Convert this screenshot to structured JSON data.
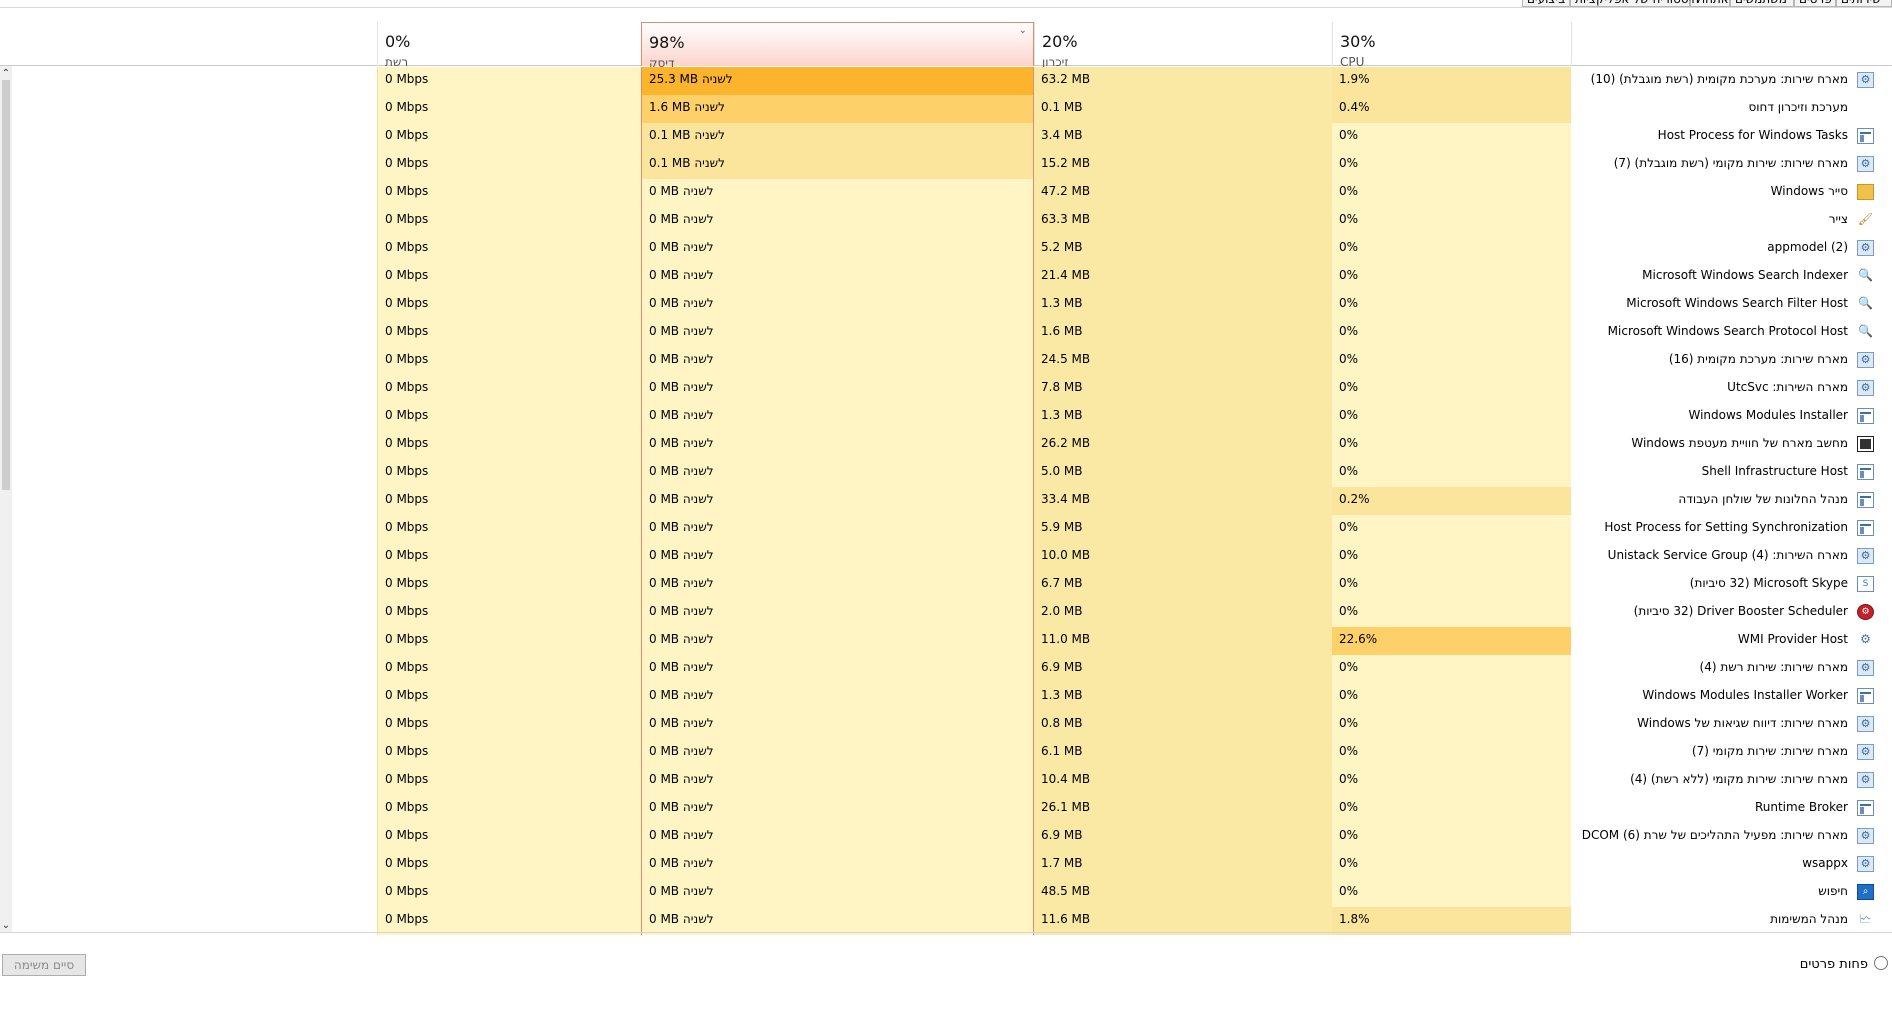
{
  "tabs": [
    "שירותים",
    "פרטים",
    "משתמשים",
    "אתחול",
    "היסטוריה של אפליקציות",
    "ביצועים"
  ],
  "header": {
    "network": {
      "percent": "0%",
      "label": "רשת"
    },
    "disk": {
      "percent": "98%",
      "label": "דיסק"
    },
    "memory": {
      "percent": "20%",
      "label": "זיכרון"
    },
    "cpu": {
      "percent": "30%",
      "label": "CPU"
    }
  },
  "icons": {
    "gear": "⚙",
    "paint": "🖌",
    "search": "🔍",
    "skype": "S",
    "driver": "⚙",
    "wmi": "⚙",
    "find": "⌕",
    "sched": "🗠"
  },
  "colors": {
    "cell_light": "#fff4c4",
    "cell_mem": "#f9e9a5",
    "heat_high": "#fcb42c",
    "heat_mid": "#fdd06a",
    "heat_low": "#fbe59c",
    "sorted_border": "#e08b72"
  },
  "processes": [
    {
      "name": "מארח שירות: מערכת מקומית (רשת מוגבלת) (10)",
      "icon": "gear",
      "cpu": "1.9%",
      "memory": "63.2 MB",
      "disk": "25.3 MB לשניה",
      "network": "0 Mbps",
      "disk_heat": "high",
      "cpu_heat": "low"
    },
    {
      "name": "מערכת וזיכרון דחוס",
      "icon": "none",
      "cpu": "0.4%",
      "memory": "0.1 MB",
      "disk": "1.6 MB לשניה",
      "network": "0 Mbps",
      "disk_heat": "mid",
      "cpu_heat": "low"
    },
    {
      "name": "Host Process for Windows Tasks",
      "icon": "win",
      "cpu": "0%",
      "memory": "3.4 MB",
      "disk": "0.1 MB לשניה",
      "network": "0 Mbps",
      "disk_heat": "low",
      "cpu_heat": ""
    },
    {
      "name": "מארח שירות: שירות מקומי (רשת מוגבלת) (7)",
      "icon": "gear",
      "cpu": "0%",
      "memory": "15.2 MB",
      "disk": "0.1 MB לשניה",
      "network": "0 Mbps",
      "disk_heat": "low",
      "cpu_heat": ""
    },
    {
      "name": "סייר Windows",
      "icon": "folder",
      "cpu": "0%",
      "memory": "47.2 MB",
      "disk": "0 MB לשניה",
      "network": "0 Mbps",
      "disk_heat": "",
      "cpu_heat": ""
    },
    {
      "name": "צייר",
      "icon": "paint",
      "cpu": "0%",
      "memory": "63.3 MB",
      "disk": "0 MB לשניה",
      "network": "0 Mbps",
      "disk_heat": "",
      "cpu_heat": ""
    },
    {
      "name": "appmodel (2)",
      "icon": "gear",
      "cpu": "0%",
      "memory": "5.2 MB",
      "disk": "0 MB לשניה",
      "network": "0 Mbps",
      "disk_heat": "",
      "cpu_heat": ""
    },
    {
      "name": "Microsoft Windows Search Indexer",
      "icon": "search",
      "cpu": "0%",
      "memory": "21.4 MB",
      "disk": "0 MB לשניה",
      "network": "0 Mbps",
      "disk_heat": "",
      "cpu_heat": ""
    },
    {
      "name": "Microsoft Windows Search Filter Host",
      "icon": "search",
      "cpu": "0%",
      "memory": "1.3 MB",
      "disk": "0 MB לשניה",
      "network": "0 Mbps",
      "disk_heat": "",
      "cpu_heat": ""
    },
    {
      "name": "Microsoft Windows Search Protocol Host",
      "icon": "search",
      "cpu": "0%",
      "memory": "1.6 MB",
      "disk": "0 MB לשניה",
      "network": "0 Mbps",
      "disk_heat": "",
      "cpu_heat": ""
    },
    {
      "name": "מארח שירות: מערכת מקומית (16)",
      "icon": "gear",
      "cpu": "0%",
      "memory": "24.5 MB",
      "disk": "0 MB לשניה",
      "network": "0 Mbps",
      "disk_heat": "",
      "cpu_heat": ""
    },
    {
      "name": "מארח השירות: UtcSvc",
      "icon": "gear",
      "cpu": "0%",
      "memory": "7.8 MB",
      "disk": "0 MB לשניה",
      "network": "0 Mbps",
      "disk_heat": "",
      "cpu_heat": ""
    },
    {
      "name": "Windows Modules Installer",
      "icon": "win",
      "cpu": "0%",
      "memory": "1.3 MB",
      "disk": "0 MB לשניה",
      "network": "0 Mbps",
      "disk_heat": "",
      "cpu_heat": ""
    },
    {
      "name": "מחשב מארח של חוויית מעטפת Windows",
      "icon": "dark",
      "cpu": "0%",
      "memory": "26.2 MB",
      "disk": "0 MB לשניה",
      "network": "0 Mbps",
      "disk_heat": "",
      "cpu_heat": ""
    },
    {
      "name": "Shell Infrastructure Host",
      "icon": "win",
      "cpu": "0%",
      "memory": "5.0 MB",
      "disk": "0 MB לשניה",
      "network": "0 Mbps",
      "disk_heat": "",
      "cpu_heat": ""
    },
    {
      "name": "מנהל החלונות של שולחן העבודה",
      "icon": "win",
      "cpu": "0.2%",
      "memory": "33.4 MB",
      "disk": "0 MB לשניה",
      "network": "0 Mbps",
      "disk_heat": "",
      "cpu_heat": "low"
    },
    {
      "name": "Host Process for Setting Synchronization",
      "icon": "win",
      "cpu": "0%",
      "memory": "5.9 MB",
      "disk": "0 MB לשניה",
      "network": "0 Mbps",
      "disk_heat": "",
      "cpu_heat": ""
    },
    {
      "name": "מארח השירות: Unistack Service Group (4)",
      "icon": "gear",
      "cpu": "0%",
      "memory": "10.0 MB",
      "disk": "0 MB לשניה",
      "network": "0 Mbps",
      "disk_heat": "",
      "cpu_heat": ""
    },
    {
      "name": "Microsoft Skype (32 סיביות)",
      "icon": "skype",
      "cpu": "0%",
      "memory": "6.7 MB",
      "disk": "0 MB לשניה",
      "network": "0 Mbps",
      "disk_heat": "",
      "cpu_heat": ""
    },
    {
      "name": "Driver Booster Scheduler (32 סיביות)",
      "icon": "red",
      "cpu": "0%",
      "memory": "2.0 MB",
      "disk": "0 MB לשניה",
      "network": "0 Mbps",
      "disk_heat": "",
      "cpu_heat": ""
    },
    {
      "name": "WMI Provider Host",
      "icon": "wmi",
      "cpu": "22.6%",
      "memory": "11.0 MB",
      "disk": "0 MB לשניה",
      "network": "0 Mbps",
      "disk_heat": "",
      "cpu_heat": "mid"
    },
    {
      "name": "מארח שירות: שירות רשת (4)",
      "icon": "gear",
      "cpu": "0%",
      "memory": "6.9 MB",
      "disk": "0 MB לשניה",
      "network": "0 Mbps",
      "disk_heat": "",
      "cpu_heat": ""
    },
    {
      "name": "Windows Modules Installer Worker",
      "icon": "win",
      "cpu": "0%",
      "memory": "1.3 MB",
      "disk": "0 MB לשניה",
      "network": "0 Mbps",
      "disk_heat": "",
      "cpu_heat": ""
    },
    {
      "name": "מארח שירות: דיווח שגיאות של Windows",
      "icon": "gear",
      "cpu": "0%",
      "memory": "0.8 MB",
      "disk": "0 MB לשניה",
      "network": "0 Mbps",
      "disk_heat": "",
      "cpu_heat": ""
    },
    {
      "name": "מארח שירות: שירות מקומי (7)",
      "icon": "gear",
      "cpu": "0%",
      "memory": "6.1 MB",
      "disk": "0 MB לשניה",
      "network": "0 Mbps",
      "disk_heat": "",
      "cpu_heat": ""
    },
    {
      "name": "מארח שירות: שירות מקומי (ללא רשת) (4)",
      "icon": "gear",
      "cpu": "0%",
      "memory": "10.4 MB",
      "disk": "0 MB לשניה",
      "network": "0 Mbps",
      "disk_heat": "",
      "cpu_heat": ""
    },
    {
      "name": "Runtime Broker",
      "icon": "win",
      "cpu": "0%",
      "memory": "26.1 MB",
      "disk": "0 MB לשניה",
      "network": "0 Mbps",
      "disk_heat": "",
      "cpu_heat": ""
    },
    {
      "name": "מארח שירות: מפעיל התהליכים של שרת DCOM (6)",
      "icon": "gear",
      "cpu": "0%",
      "memory": "6.9 MB",
      "disk": "0 MB לשניה",
      "network": "0 Mbps",
      "disk_heat": "",
      "cpu_heat": ""
    },
    {
      "name": "wsappx",
      "icon": "gear",
      "cpu": "0%",
      "memory": "1.7 MB",
      "disk": "0 MB לשניה",
      "network": "0 Mbps",
      "disk_heat": "",
      "cpu_heat": ""
    },
    {
      "name": "חיפוש",
      "icon": "find",
      "cpu": "0%",
      "memory": "48.5 MB",
      "disk": "0 MB לשניה",
      "network": "0 Mbps",
      "disk_heat": "",
      "cpu_heat": ""
    },
    {
      "name": "מנהל המשימות",
      "icon": "sched",
      "cpu": "1.8%",
      "memory": "11.6 MB",
      "disk": "0 MB לשניה",
      "network": "0 Mbps",
      "disk_heat": "",
      "cpu_heat": "low"
    }
  ],
  "footer": {
    "end_task_label": "סיים משימה",
    "fewer_details_label": "פחות פרטים"
  }
}
